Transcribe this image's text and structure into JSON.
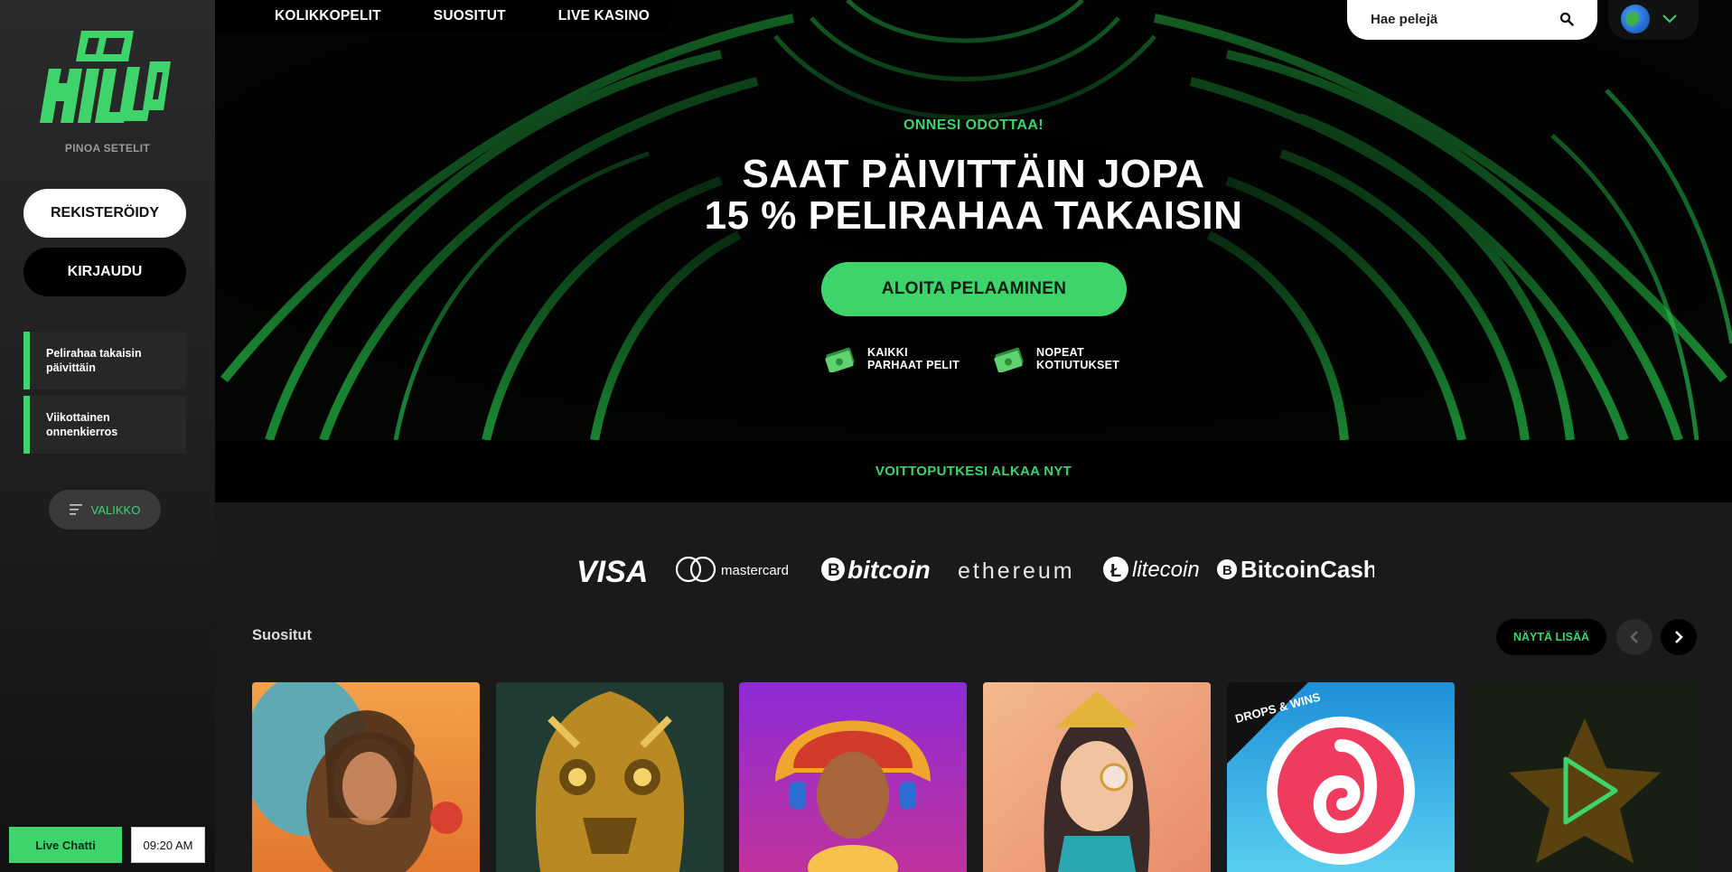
{
  "brand": {
    "name": "HILLO",
    "tagline": "PINOA SETELIT",
    "accent": "#3ed46b"
  },
  "sidebar": {
    "register_label": "REKISTERÖIDY",
    "login_label": "KIRJAUDU",
    "promos": [
      {
        "label": "Pelirahaa takaisin päivittäin"
      },
      {
        "label": "Viikottainen onnenkierros"
      }
    ],
    "menu_label": "VALIKKO",
    "live_chat_label": "Live Chatti",
    "clock": "09:20 AM"
  },
  "nav": {
    "items": [
      {
        "label": "KOLIKKOPELIT"
      },
      {
        "label": "SUOSITUT"
      },
      {
        "label": "LIVE KASINO"
      }
    ],
    "search_placeholder": "Hae pelejä",
    "language_icon": "globe-icon"
  },
  "hero": {
    "kicker": "ONNESI ODOTTAA!",
    "headline_line1": "SAAT PÄIVITTÄIN JOPA",
    "headline_line2": "15 % PELIRAHAA TAKAISIN",
    "cta_label": "ALOITA PELAAMINEN",
    "features": [
      {
        "line1": "KAIKKI",
        "line2": "PARHAAT PELIT",
        "icon": "cash-icon"
      },
      {
        "line1": "NOPEAT",
        "line2": "KOTIUTUKSET",
        "icon": "cash-icon"
      }
    ],
    "strip_text": "VOITTOPUTKESI ALKAA NYT"
  },
  "payments": {
    "visa": "VISA",
    "mastercard": "mastercard",
    "bitcoin": "bitcoin",
    "ethereum": "ethereum",
    "litecoin": "litecoin",
    "bitcoincash": "BitcoinCash"
  },
  "popular": {
    "title": "Suositut",
    "show_more_label": "NÄYTÄ LISÄÄ",
    "tiles": [
      {
        "badge": ""
      },
      {
        "badge": ""
      },
      {
        "badge": ""
      },
      {
        "badge": ""
      },
      {
        "badge": "DROPS & WINS"
      },
      {
        "badge": ""
      }
    ]
  }
}
